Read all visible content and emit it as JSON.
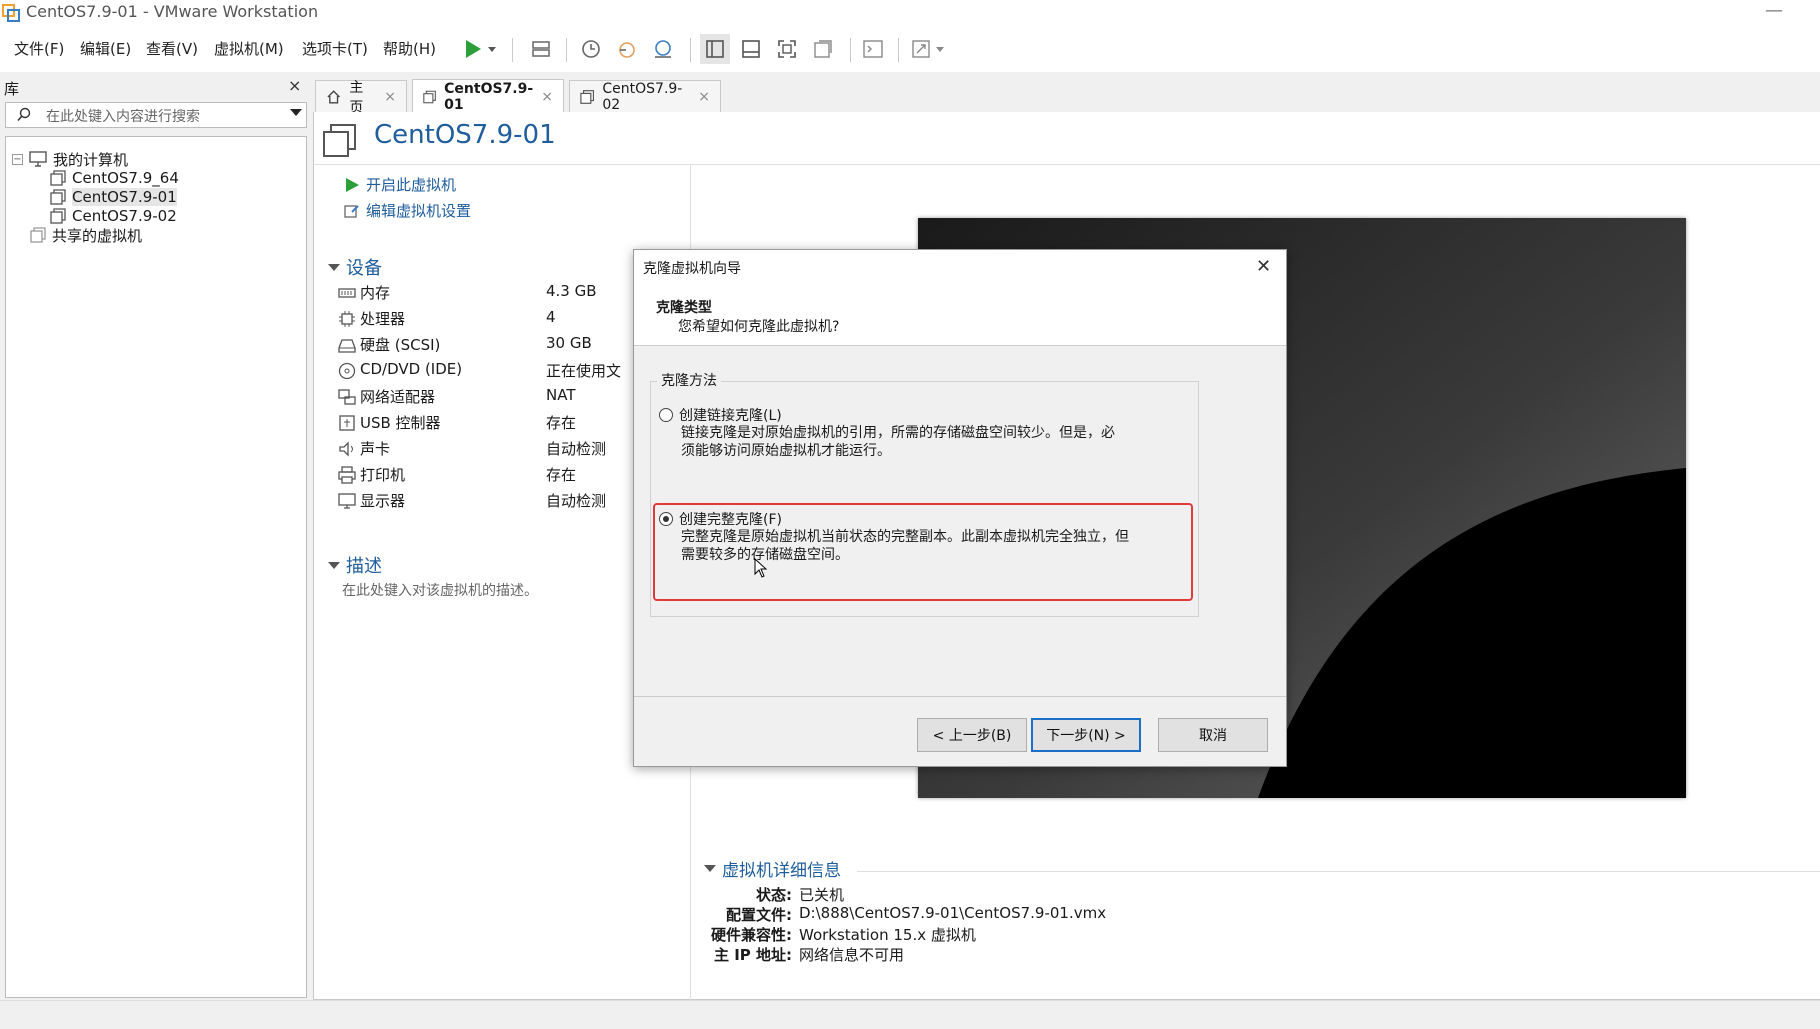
{
  "window": {
    "title": "CentOS7.9-01 - VMware Workstation",
    "minimize": "—"
  },
  "menu": [
    "文件(F)",
    "编辑(E)",
    "查看(V)",
    "虚拟机(M)",
    "选项卡(T)",
    "帮助(H)"
  ],
  "library": {
    "title": "库",
    "close": "×",
    "search_placeholder": "在此处键入内容进行搜索",
    "tree": {
      "root": "我的计算机",
      "vms": [
        "CentOS7.9_64",
        "CentOS7.9-01",
        "CentOS7.9-02"
      ],
      "selected": "CentOS7.9-01",
      "shared": "共享的虚拟机"
    }
  },
  "tabs": [
    {
      "label": "主页",
      "active": false
    },
    {
      "label": "CentOS7.9-01",
      "active": true
    },
    {
      "label": "CentOS7.9-02",
      "active": false
    }
  ],
  "tab_close": "×",
  "vm": {
    "title": "CentOS7.9-01",
    "actions": {
      "power_on": "开启此虚拟机",
      "edit_settings": "编辑虚拟机设置"
    },
    "devices_header": "设备",
    "devices": [
      {
        "name": "内存",
        "value": "4.3 GB",
        "icon": "memory-icon"
      },
      {
        "name": "处理器",
        "value": "4",
        "icon": "cpu-icon"
      },
      {
        "name": "硬盘 (SCSI)",
        "value": "30 GB",
        "icon": "harddisk-icon"
      },
      {
        "name": "CD/DVD (IDE)",
        "value": "正在使用文",
        "icon": "cd-icon"
      },
      {
        "name": "网络适配器",
        "value": "NAT",
        "icon": "network-icon"
      },
      {
        "name": "USB 控制器",
        "value": "存在",
        "icon": "usb-icon"
      },
      {
        "name": "声卡",
        "value": "自动检测",
        "icon": "sound-icon"
      },
      {
        "name": "打印机",
        "value": "存在",
        "icon": "printer-icon"
      },
      {
        "name": "显示器",
        "value": "自动检测",
        "icon": "display-icon"
      }
    ],
    "description_header": "描述",
    "description_placeholder": "在此处键入对该虚拟机的描述。",
    "details_header": "虚拟机详细信息",
    "details": [
      {
        "key": "状态:",
        "value": "已关机"
      },
      {
        "key": "配置文件:",
        "value": "D:\\888\\CentOS7.9-01\\CentOS7.9-01.vmx"
      },
      {
        "key": "硬件兼容性:",
        "value": "Workstation 15.x 虚拟机"
      },
      {
        "key": "主 IP 地址:",
        "value": "网络信息不可用"
      }
    ]
  },
  "dialog": {
    "title": "克隆虚拟机向导",
    "close": "✕",
    "step_title": "克隆类型",
    "step_subtitle": "您希望如何克隆此虚拟机?",
    "group_label": "克隆方法",
    "options": [
      {
        "label": "创建链接克隆(L)",
        "desc1": "链接克隆是对原始虚拟机的引用，所需的存储磁盘空间较少。但是，必",
        "desc2": "须能够访问原始虚拟机才能运行。",
        "selected": false
      },
      {
        "label": "创建完整克隆(F)",
        "desc1": "完整克隆是原始虚拟机当前状态的完整副本。此副本虚拟机完全独立，但",
        "desc2": "需要较多的存储磁盘空间。",
        "selected": true
      }
    ],
    "buttons": {
      "back": "< 上一步(B)",
      "next": "下一步(N) >",
      "cancel": "取消"
    }
  },
  "colors": {
    "accent": "#1f5d9c",
    "highlight": "#e03b3b",
    "play": "#2e9e3a"
  }
}
